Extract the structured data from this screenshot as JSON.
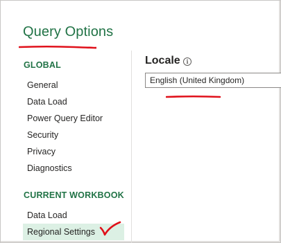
{
  "dialog": {
    "title": "Query Options"
  },
  "sidebar": {
    "global_header": "GLOBAL",
    "global_items": [
      {
        "label": "General"
      },
      {
        "label": "Data Load"
      },
      {
        "label": "Power Query Editor"
      },
      {
        "label": "Security"
      },
      {
        "label": "Privacy"
      },
      {
        "label": "Diagnostics"
      }
    ],
    "workbook_header": "CURRENT WORKBOOK",
    "workbook_items": [
      {
        "label": "Data Load",
        "selected": false
      },
      {
        "label": "Regional Settings",
        "selected": true
      }
    ]
  },
  "main": {
    "heading": "Locale",
    "info_icon": "info-icon",
    "locale_value": "English (United Kingdom)"
  },
  "annotations": {
    "color": "#e0101a",
    "title_underline": true,
    "locale_underline": true,
    "selected_checkmark": true
  },
  "colors": {
    "accent": "#217346",
    "selected_bg": "#dcf0e4"
  }
}
